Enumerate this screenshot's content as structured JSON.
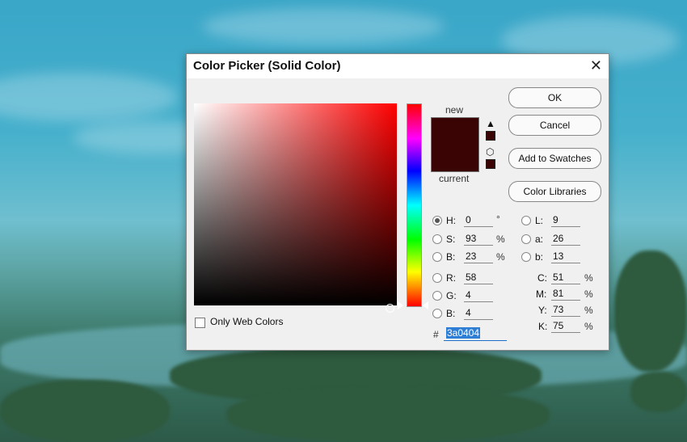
{
  "dialog": {
    "title": "Color Picker (Solid Color)",
    "close_glyph": "✕",
    "new_label": "new",
    "current_label": "current",
    "swatch_color": "#3a0404",
    "buttons": {
      "ok": "OK",
      "cancel": "Cancel",
      "add_to_swatches": "Add to Swatches",
      "color_libraries": "Color Libraries"
    },
    "hsb": {
      "h_label": "H:",
      "h_value": "0",
      "h_unit": "°",
      "s_label": "S:",
      "s_value": "93",
      "s_unit": "%",
      "b_label": "B:",
      "b_value": "23",
      "b_unit": "%"
    },
    "rgb": {
      "r_label": "R:",
      "r_value": "58",
      "g_label": "G:",
      "g_value": "4",
      "b_label": "B:",
      "b_value": "4"
    },
    "lab": {
      "l_label": "L:",
      "l_value": "9",
      "a_label": "a:",
      "a_value": "26",
      "b_label": "b:",
      "b_value": "13"
    },
    "cmyk": {
      "c_label": "C:",
      "c_value": "51",
      "c_unit": "%",
      "m_label": "M:",
      "m_value": "81",
      "m_unit": "%",
      "y_label": "Y:",
      "y_value": "73",
      "y_unit": "%",
      "k_label": "K:",
      "k_value": "75",
      "k_unit": "%"
    },
    "hex_label": "#",
    "hex_value": "3a0404",
    "only_web_colors": "Only Web Colors",
    "icons": {
      "warning": "warning-triangle-icon",
      "cube": "web-safe-cube-icon"
    }
  }
}
